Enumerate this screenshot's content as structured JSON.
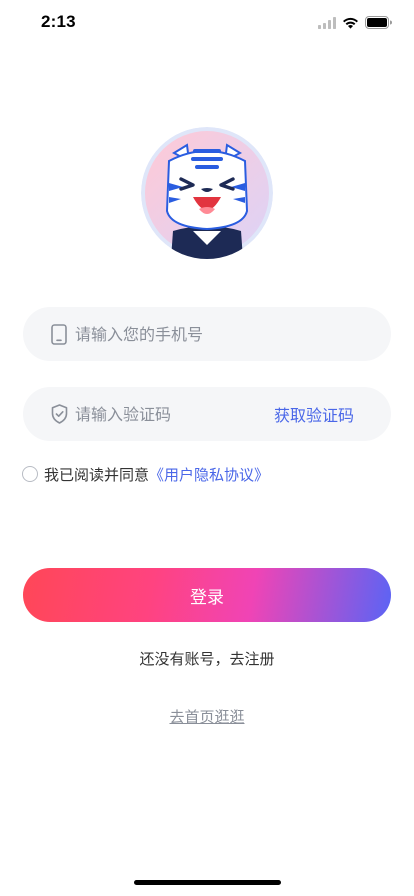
{
  "status_bar": {
    "time": "2:13",
    "icons": [
      "cellular-signal-icon",
      "wifi-icon",
      "battery-icon"
    ]
  },
  "avatar": {
    "icon": "tiger-mascot-icon"
  },
  "phone_field": {
    "placeholder": "请输入您的手机号",
    "value": "",
    "icon": "phone-icon"
  },
  "code_field": {
    "placeholder": "请输入验证码",
    "value": "",
    "icon": "shield-check-icon",
    "get_code_label": "获取验证码"
  },
  "agreement": {
    "checked": false,
    "text": "我已阅读并同意",
    "link": "《用户隐私协议》"
  },
  "login_button": {
    "label": "登录"
  },
  "register_link": "还没有账号，去注册",
  "browse_link": "去首页逛逛",
  "colors": {
    "accent_blue": "#4a67e8",
    "field_background": "#f5f6f8",
    "gradient_start": "#ff4757",
    "gradient_mid": "#f044b5",
    "gradient_end": "#5a64f5"
  }
}
